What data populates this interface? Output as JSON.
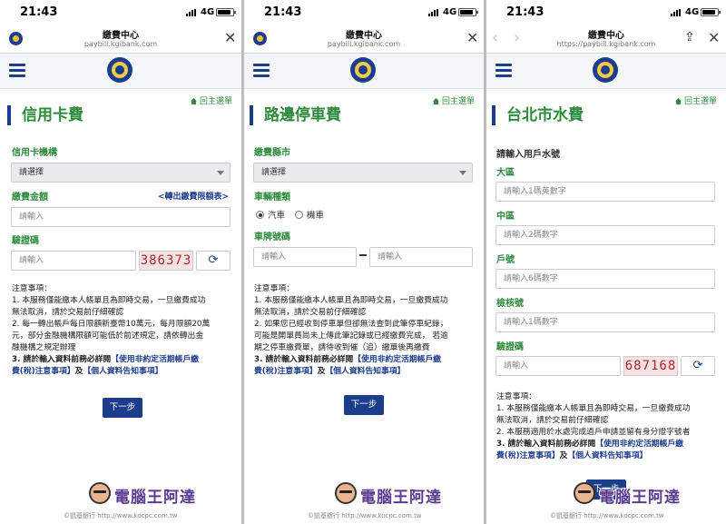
{
  "panels": [
    {
      "status": {
        "time": "21:43",
        "network": "4G"
      },
      "browser": {
        "title": "繳費中心",
        "url": "paybill.kgibank.com"
      },
      "back_link": "回主選單",
      "page_title": "信用卡費",
      "form": {
        "bank_label": "信用卡機構",
        "bank_select": "請選擇",
        "amount_label": "繳費金額",
        "limit_link": "<轉出繳費限額表>",
        "amount_placeholder": "請輸入",
        "captcha_label": "驗證碼",
        "captcha_placeholder": "請輸入",
        "captcha_code": "386373"
      },
      "notes": {
        "heading": "注意事項：",
        "lines": [
          "1. 本服務僅能繳本人帳單且為即時交易，一旦繳費成功",
          "無法取消，請於交易前仔細確認",
          "2. 每一轉出帳戶每日限額新臺幣10萬元，每月限額20萬",
          "元，部分金融機構限額可能低於前述規定，請依轉出金",
          "融機構之規定辦理"
        ],
        "item3_prefix": "3. 請於輸入資料前務必詳閱",
        "item3_link1a": "【使用非約定活期帳戶繳",
        "item3_link1b": "費(稅)注意事項】",
        "item3_and": "及",
        "item3_link2": "【個人資料告知事項】"
      },
      "next_button": "下一步"
    },
    {
      "status": {
        "time": "21:43",
        "network": "4G"
      },
      "browser": {
        "title": "繳費中心",
        "url": "paybill.kgibank.com"
      },
      "back_link": "回主選單",
      "page_title": "路邊停車費",
      "form": {
        "city_label": "繳費縣市",
        "city_select": "請選擇",
        "vehicle_label": "車輛種類",
        "vehicle_car": "汽車",
        "vehicle_moto": "機車",
        "plate_label": "車牌號碼",
        "plate_placeholder1": "請輸入",
        "plate_placeholder2": "請輸入"
      },
      "notes": {
        "heading": "注意事項：",
        "lines": [
          "1. 本服務僅能繳本人帳單且為即時交易，一旦繳費成功",
          "無法取消，請於交易前仔細確認",
          "2. 如果您已經收到停車單但卻無法查到此筆停車紀錄，",
          "可能是開單員尚未上傳此筆記錄或已經繳費完成， 若逾",
          "期之停車繳費單，請待收到催（追）繳單後再繳費"
        ],
        "item3_prefix": "3. 請於輸入資料前務必詳閱",
        "item3_link1a": "【使用非約定活期帳戶繳",
        "item3_link1b": "費(稅)注意事項】",
        "item3_and": "及",
        "item3_link2": "【個人資料告知事項】"
      },
      "next_button": "下一步"
    },
    {
      "status": {
        "time": "21:43",
        "network": "4G"
      },
      "browser": {
        "title": "繳費中心",
        "url": "https://paybill.kgibank.com"
      },
      "back_link": "回主選單",
      "page_title": "台北市水費",
      "form": {
        "intro": "請輸入用戶水號",
        "district_label": "大區",
        "district_placeholder": "請輸入1碼英數字",
        "mid_label": "中區",
        "mid_placeholder": "請輸入2碼數字",
        "account_label": "戶號",
        "account_placeholder": "請輸入6碼數字",
        "check_label": "檢核號",
        "check_placeholder": "請輸入1碼數字",
        "captcha_label": "驗證碼",
        "captcha_placeholder": "請輸入",
        "captcha_code": "687168"
      },
      "notes": {
        "heading": "注意事項：",
        "lines": [
          "1. 本服務僅能繳本人帳單且為即時交易，一旦繳費成功",
          "無法取消，請於交易前仔細確認",
          "2. 本服務適用於水處完成過戶申請並留有身分證字號者"
        ],
        "item3_prefix": "3. 請於輸入資料前務必詳閱",
        "item3_link1a": "【使用非約定活期帳戶繳",
        "item3_link1b": "費(稅)注意事項】",
        "item3_and": "及",
        "item3_link2": "【個人資料告知事項】"
      },
      "next_button": "下一步"
    }
  ],
  "watermark": {
    "text": "電腦王阿達",
    "sub1": "©凱基銀行",
    "sub2": "http://www.kocpc.com.tw"
  },
  "colors": {
    "green": "#2e8b3c",
    "navy": "#1c3d8c",
    "captcha_red": "#b3262e"
  }
}
